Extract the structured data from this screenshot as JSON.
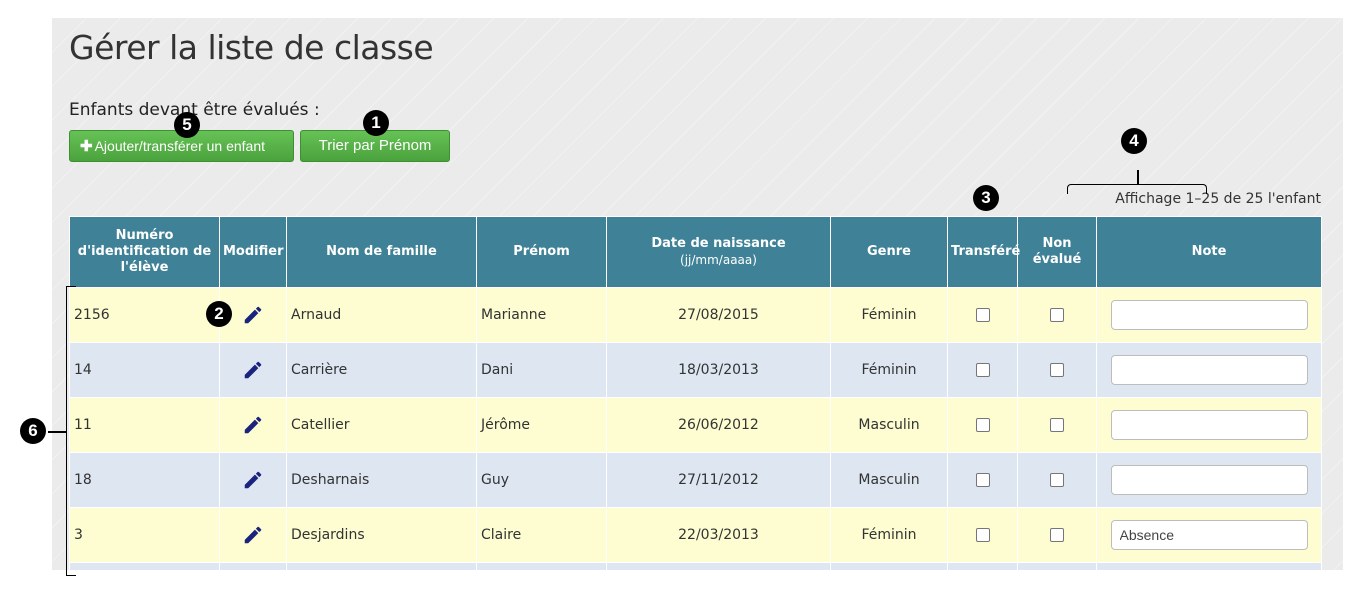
{
  "page": {
    "title": "Gérer la liste de classe",
    "subtitle": "Enfants devant être évalués :"
  },
  "toolbar": {
    "add_label": "Ajouter/transférer un enfant",
    "add_icon": "plus-icon",
    "sort_label": "Trier par Prénom"
  },
  "pagination": {
    "text": "Affichage 1–25 de 25 l'enfant"
  },
  "table": {
    "headers": {
      "id": "Numéro d'identification de l'élève",
      "edit": "Modifier",
      "last_name": "Nom de famille",
      "first_name": "Prénom",
      "birth_date": "Date de naissance",
      "birth_date_format": "(jj/mm/aaaa)",
      "gender": "Genre",
      "transferred": "Transféré",
      "not_evaluated": "Non évalué",
      "note": "Note"
    },
    "rows": [
      {
        "id": "2156",
        "last_name": "Arnaud",
        "first_name": "Marianne",
        "birth_date": "27/08/2015",
        "gender": "Féminin",
        "transferred": false,
        "not_evaluated": false,
        "note": ""
      },
      {
        "id": "14",
        "last_name": "Carrière",
        "first_name": "Dani",
        "birth_date": "18/03/2013",
        "gender": "Féminin",
        "transferred": false,
        "not_evaluated": false,
        "note": ""
      },
      {
        "id": "11",
        "last_name": "Catellier",
        "first_name": "Jérôme",
        "birth_date": "26/06/2012",
        "gender": "Masculin",
        "transferred": false,
        "not_evaluated": false,
        "note": ""
      },
      {
        "id": "18",
        "last_name": "Desharnais",
        "first_name": "Guy",
        "birth_date": "27/11/2012",
        "gender": "Masculin",
        "transferred": false,
        "not_evaluated": false,
        "note": ""
      },
      {
        "id": "3",
        "last_name": "Desjardins",
        "first_name": "Claire",
        "birth_date": "22/03/2013",
        "gender": "Féminin",
        "transferred": false,
        "not_evaluated": false,
        "note": "Absence"
      }
    ]
  },
  "callouts": [
    "1",
    "2",
    "3",
    "4",
    "5",
    "6"
  ],
  "colors": {
    "header_bg": "#3f8298",
    "row_odd": "#fdfdd1",
    "row_even": "#dde6f1",
    "button_green": "#5cb85c",
    "pencil": "#1a237e"
  },
  "icons": {
    "edit": "pencil-icon"
  }
}
